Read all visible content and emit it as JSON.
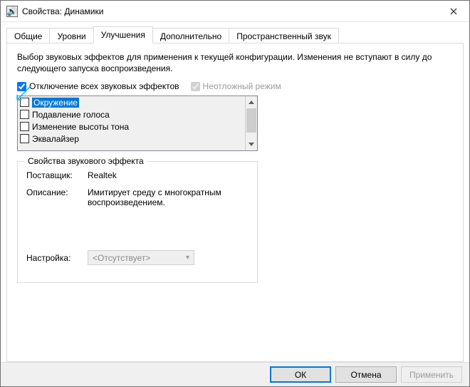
{
  "window": {
    "title": "Свойства: Динамики",
    "icon_glyph": "🔊"
  },
  "tabs": [
    {
      "label": "Общие"
    },
    {
      "label": "Уровни"
    },
    {
      "label": "Улучшения"
    },
    {
      "label": "Дополнительно"
    },
    {
      "label": "Пространственный звук"
    }
  ],
  "active_tab_index": 2,
  "enhancements": {
    "description": "Выбор звуковых эффектов для применения к текущей конфигурации. Изменения не вступают в силу до следующего запуска воспроизведения.",
    "disable_all_label": "Отключение всех звуковых эффектов",
    "disable_all_checked": true,
    "immediate_mode_label": "Неотложный режим",
    "immediate_mode_checked": true,
    "effects": [
      {
        "label": "Окружение",
        "checked": false,
        "selected": true
      },
      {
        "label": "Подавление голоса",
        "checked": false,
        "selected": false
      },
      {
        "label": "Изменение высоты тона",
        "checked": false,
        "selected": false
      },
      {
        "label": "Эквалайзер",
        "checked": false,
        "selected": false
      }
    ],
    "properties": {
      "legend": "Свойства звукового эффекта",
      "provider_label": "Поставщик:",
      "provider_value": "Realtek",
      "description_label": "Описание:",
      "description_value": "Имитирует среду с многократным воспроизведением.",
      "setting_label": "Настройка:",
      "setting_value": "<Отсутствует>"
    }
  },
  "buttons": {
    "ok": "ОК",
    "cancel": "Отмена",
    "apply": "Применить"
  }
}
